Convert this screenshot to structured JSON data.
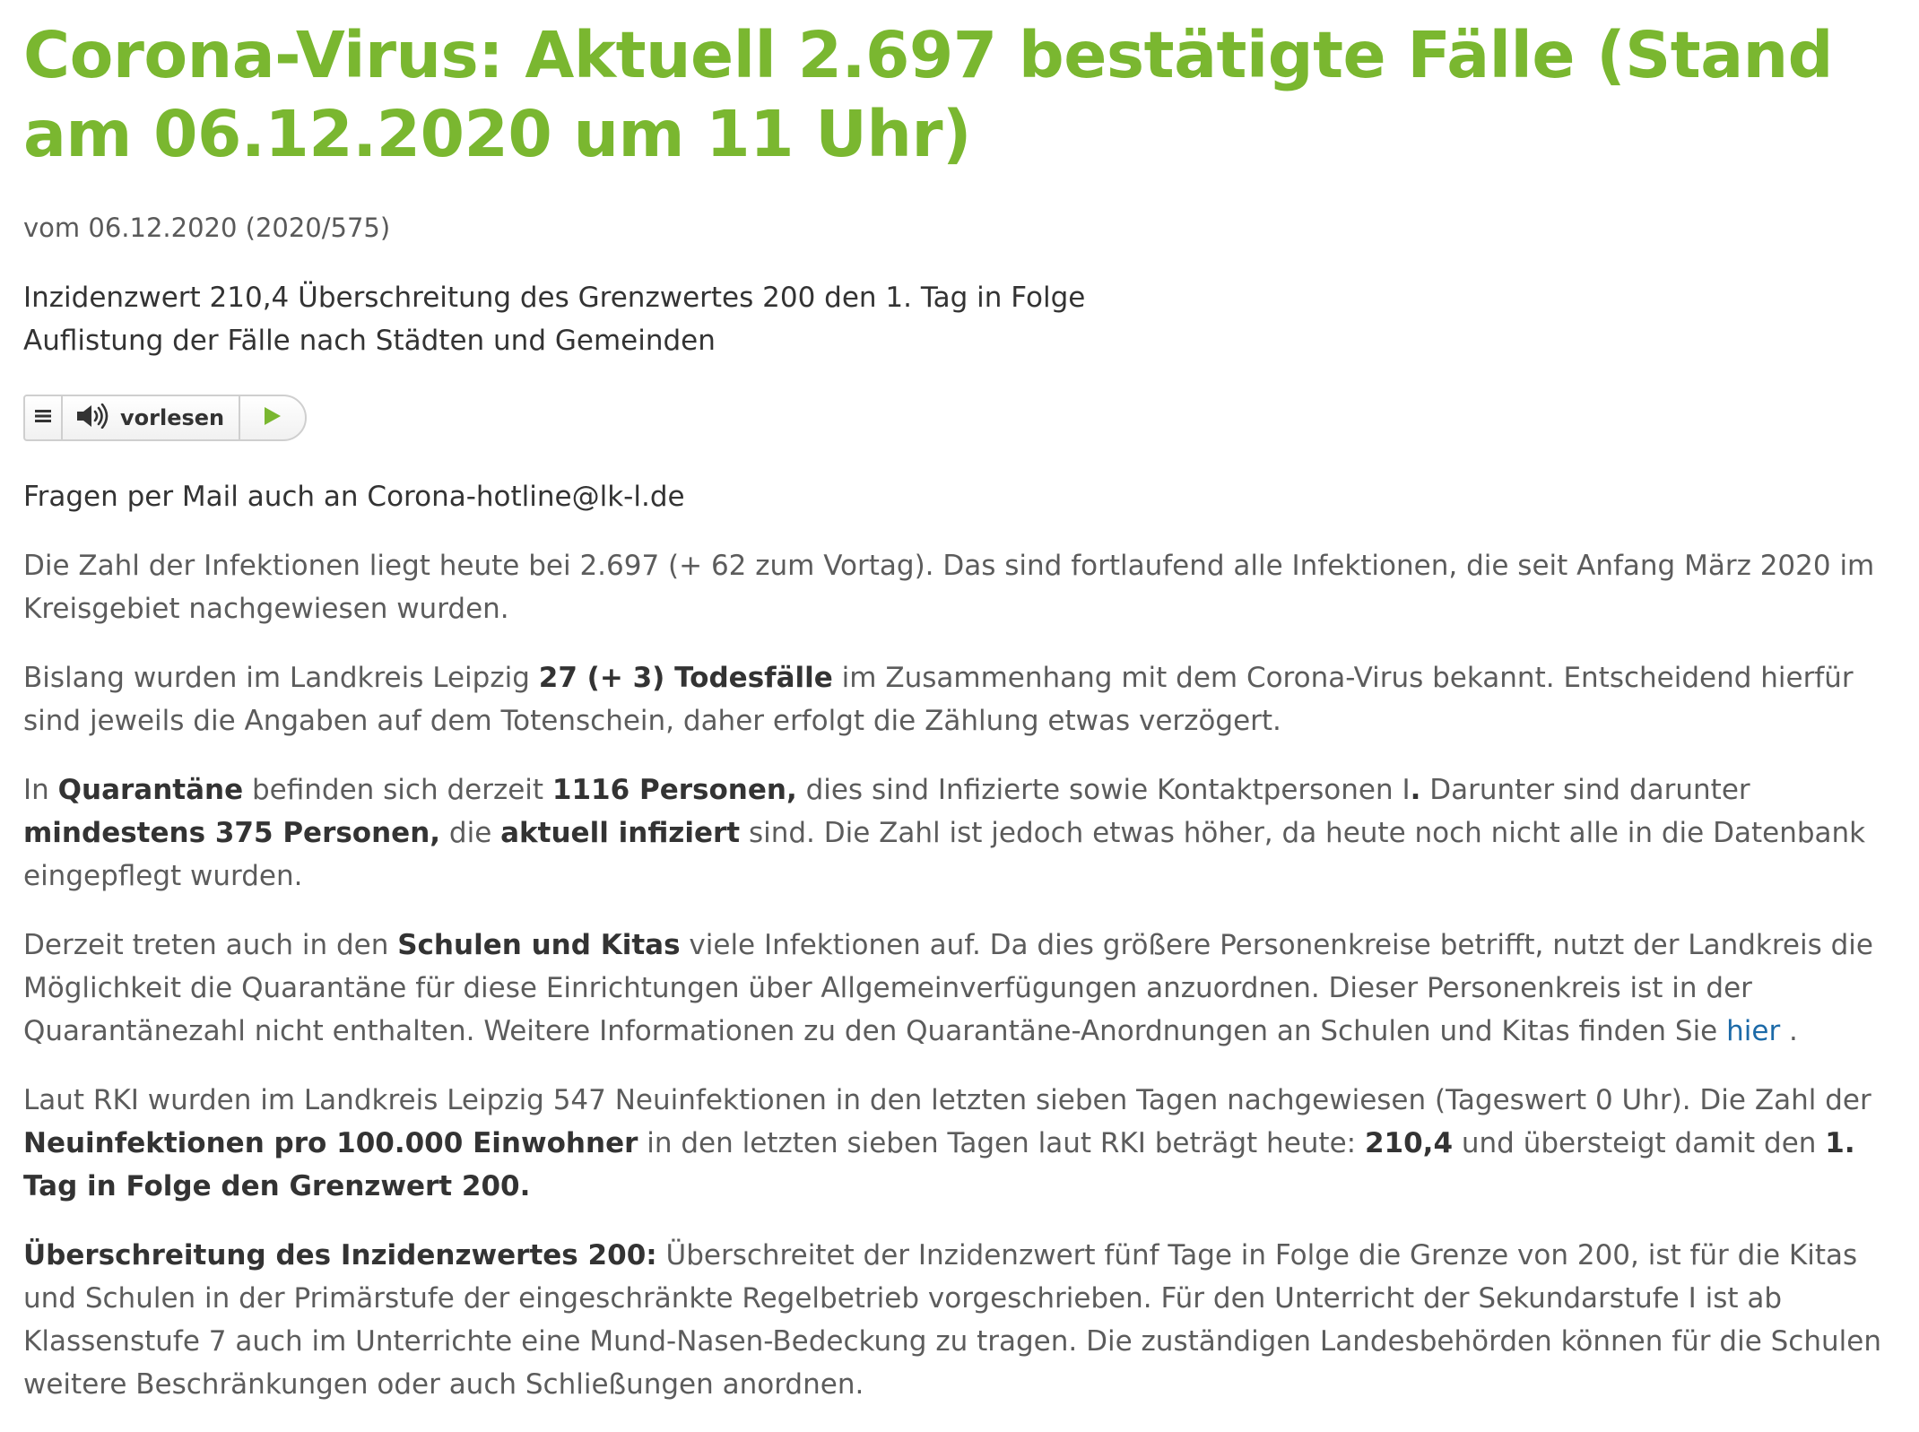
{
  "title": "Corona-Virus: Aktuell 2.697 bestätigte Fälle (Stand am 06.12.2020 um 11 Uhr)",
  "meta": "vom 06.12.2020 (2020/575)",
  "subtitle": {
    "line1": "Inzidenzwert 210,4 Überschreitung des Grenzwertes 200 den 1. Tag in Folge",
    "line2": "Auflistung der Fälle nach Städten und Gemeinden"
  },
  "player": {
    "read_label": "vorlesen",
    "icons": [
      "menu-icon",
      "speaker-icon",
      "play-icon"
    ],
    "accent": "#7ab730"
  },
  "colors": {
    "title": "#7ab730",
    "link": "#1c6aa8",
    "text": "#5c5c5c",
    "strong": "#333333"
  },
  "content": {
    "p1": "Fragen per Mail auch an Corona-hotline@lk-l.de",
    "p2": "Die Zahl der Infektionen liegt heute bei 2.697 (+ 62 zum Vortag). Das sind fortlaufend alle Infektionen, die seit Anfang März 2020 im Kreisgebiet nachgewiesen wurden.",
    "p3": {
      "t1": "Bislang wurden im Landkreis Leipzig ",
      "b1": "27 (+ 3) Todesfälle",
      "t2": " im Zusammenhang mit dem Corona-Virus bekannt. Entscheidend hierfür sind jeweils die Angaben auf dem Totenschein, daher erfolgt die Zählung etwas verzögert."
    },
    "p4": {
      "t1": "In ",
      "b1": "Quarantäne",
      "t2": " befinden sich derzeit ",
      "b2": "1116 Personen,",
      "t3": " dies sind Infizierte sowie Kontaktpersonen I",
      "b3": ".",
      "t4": " Darunter sind darunter ",
      "b4": "mindestens 375 Personen,",
      "t5": " die ",
      "b5": "aktuell infiziert",
      "t6": " sind. Die Zahl ist jedoch etwas höher, da heute noch nicht alle in die Datenbank eingepflegt wurden."
    },
    "p5": {
      "t1": "Derzeit treten auch in den ",
      "b1": "Schulen und Kitas",
      "t2": " viele Infektionen auf. Da dies größere Personenkreise betrifft, nutzt der Landkreis die Möglichkeit die Quarantäne für diese Einrichtungen über Allgemeinverfügungen anzuordnen. Dieser Personenkreis ist in der Quarantänezahl nicht enthalten. Weitere Informationen zu den Quarantäne-Anordnungen an Schulen und Kitas finden Sie ",
      "link": "hier",
      "t3": " ."
    },
    "p6": {
      "t1": "Laut RKI wurden im Landkreis Leipzig 547 Neuinfektionen in den letzten sieben Tagen nachgewiesen (Tageswert 0 Uhr). Die Zahl der ",
      "b1": "Neuinfektionen pro 100.000 Einwohner",
      "t2": " in den letzten sieben Tagen laut RKI beträgt heute: ",
      "b2": "210,4",
      "t3": " und übersteigt damit den ",
      "b3": "1. Tag in Folge den Grenzwert 200."
    },
    "p7": {
      "b1": "Überschreitung des Inzidenzwertes 200:",
      "t1": " Überschreitet der Inzidenzwert fünf Tage in Folge die Grenze von 200, ist für die Kitas und Schulen in der Primärstufe der eingeschränkte Regelbetrieb vorgeschrieben. Für den Unterricht der Sekundarstufe I ist ab Klassenstufe 7 auch im Unterrichte eine Mund-Nasen-Bedeckung zu tragen. Die zuständigen Landesbehörden können für die Schulen weitere Beschränkungen oder auch Schließungen anordnen."
    }
  }
}
